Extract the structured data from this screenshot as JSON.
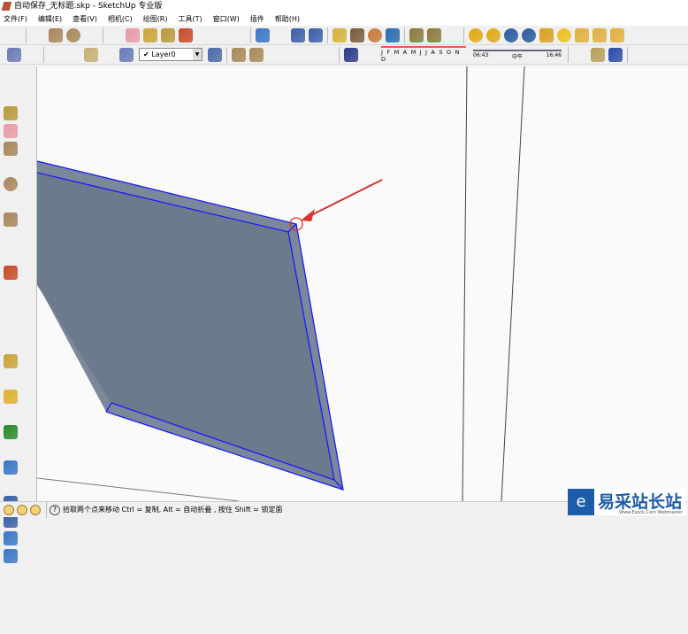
{
  "window": {
    "title": "自动保存_无标题.skp - SketchUp 专业版"
  },
  "menu": [
    "文件(F)",
    "编辑(E)",
    "查看(V)",
    "相机(C)",
    "绘图(R)",
    "工具(T)",
    "窗口(W)",
    "插件",
    "帮助(H)"
  ],
  "toolbar1": [
    {
      "icon": "select-arrow-icon",
      "color": "#333"
    },
    {
      "sep": true
    },
    {
      "icon": "pencil-icon",
      "color": "#d33"
    },
    {
      "icon": "rectangle-icon",
      "color": "#a8865a"
    },
    {
      "icon": "circle-icon",
      "color": "#a8865a"
    },
    {
      "icon": "arc-icon",
      "color": "#555"
    },
    {
      "sep": true
    },
    {
      "icon": "make-component-icon",
      "color": "#ccc"
    },
    {
      "icon": "eraser-icon",
      "color": "#e89aa8"
    },
    {
      "icon": "tape-measure-icon",
      "color": "#c9a43a"
    },
    {
      "icon": "paint-bucket-icon",
      "color": "#b89a3a"
    },
    {
      "icon": "push-pull-icon",
      "color": "#c94a2a"
    },
    {
      "icon": "move-icon",
      "color": "#d22"
    },
    {
      "icon": "rotate-icon",
      "color": "#d22"
    },
    {
      "icon": "follow-me-icon",
      "color": "#c33"
    },
    {
      "sep": true
    },
    {
      "icon": "orbit-icon",
      "color": "#3a76c4"
    },
    {
      "icon": "pan-icon",
      "color": "#aaa"
    },
    {
      "icon": "zoom-icon",
      "color": "#3a5ea8"
    },
    {
      "icon": "zoom-extents-icon",
      "color": "#3a5ea8"
    },
    {
      "sep": true
    },
    {
      "icon": "add-location-icon",
      "color": "#d6b23a"
    },
    {
      "icon": "photo-textures-icon",
      "color": "#7a5a3a"
    },
    {
      "icon": "google-earth-icon",
      "color": "#c8793a"
    },
    {
      "icon": "toggle-terrain-icon",
      "color": "#2a6ab0"
    },
    {
      "sep": true
    },
    {
      "icon": "get-models-icon",
      "color": "#8a7a3a"
    },
    {
      "icon": "share-model-icon",
      "color": "#8a7a3a"
    },
    {
      "icon": "share-component-icon",
      "color": "#ccc"
    },
    {
      "sep": true
    },
    {
      "icon": "m-plugin-icon",
      "color": "#e2a814"
    },
    {
      "icon": "plugin-icon",
      "color": "#e2a814"
    },
    {
      "icon": "r-plugin-icon",
      "color": "#2a5aa0"
    },
    {
      "icon": "help-icon",
      "color": "#2a5aa0"
    },
    {
      "icon": "tag-icon",
      "color": "#d8a020"
    },
    {
      "icon": "sun-icon",
      "color": "#f0c020"
    },
    {
      "icon": "light-icon",
      "color": "#e0b040"
    },
    {
      "icon": "spot-icon",
      "color": "#e0b040"
    },
    {
      "icon": "pin-icon",
      "color": "#e0b040"
    },
    {
      "icon": "sphere-icon",
      "color": "#bbb"
    }
  ],
  "toolbar2a": [
    {
      "icon": "xray-icon",
      "color": "#6a7ab8"
    },
    {
      "icon": "back-edges-icon",
      "color": "#ddd"
    },
    {
      "sep": true
    },
    {
      "icon": "wireframe-icon",
      "color": "#ddd"
    },
    {
      "icon": "hidden-line-icon",
      "color": "#eee"
    },
    {
      "icon": "shaded-icon",
      "color": "#c8b070"
    },
    {
      "icon": "shaded-textures-icon",
      "color": "#333"
    },
    {
      "icon": "monochrome-icon",
      "color": "#6a7ab8"
    }
  ],
  "layer": {
    "check": "✔",
    "name": "Layer0"
  },
  "toolbar2b": [
    {
      "icon": "layer-manager-icon",
      "color": "#4a6aa8"
    },
    {
      "sep": true
    },
    {
      "icon": "iso-view-icon",
      "color": "#a88a5a"
    },
    {
      "icon": "top-view-icon",
      "color": "#a88a5a"
    },
    {
      "icon": "front-view-icon",
      "color": "#333"
    },
    {
      "icon": "right-view-icon",
      "color": "#999"
    },
    {
      "icon": "back-view-icon",
      "color": "#777"
    },
    {
      "icon": "left-view-icon",
      "color": "#999"
    },
    {
      "sep": true
    },
    {
      "icon": "shadow-settings-icon",
      "color": "#2a3a8a"
    },
    {
      "icon": "display-shadows-icon",
      "color": "#222"
    }
  ],
  "shadows": {
    "months": "J F M A M J J A S O N D",
    "time_start": "06:43",
    "time_mid": "中午",
    "time_end": "16:46"
  },
  "toolbar2c": [
    {
      "sep": true
    },
    {
      "icon": "new-icon",
      "color": "#eee"
    },
    {
      "icon": "open-icon",
      "color": "#b8a05a"
    },
    {
      "icon": "save-icon",
      "color": "#2a4aa8"
    },
    {
      "sep": true
    },
    {
      "icon": "cut-icon",
      "color": "#c33"
    },
    {
      "icon": "copy-icon",
      "color": "#ddd"
    },
    {
      "icon": "paste-icon",
      "color": "#ddd"
    }
  ],
  "leftbar": [
    {
      "icon": "select-icon",
      "color": "#333"
    },
    {
      "icon": "component-icon",
      "color": "#ddd"
    },
    {
      "icon": "paint-bucket-icon",
      "color": "#b89a3a"
    },
    {
      "icon": "eraser-icon",
      "color": "#e89aa8"
    },
    {
      "icon": "rectangle-icon",
      "color": "#a8865a"
    },
    {
      "icon": "line-icon",
      "color": "#d33"
    },
    {
      "icon": "circle-icon",
      "color": "#a8865a"
    },
    {
      "icon": "arc-icon",
      "color": "#555"
    },
    {
      "icon": "polygon-icon",
      "color": "#a8865a"
    },
    {
      "icon": "freehand-icon",
      "color": "#555"
    },
    {
      "icon": "move-icon",
      "color": "#d22"
    },
    {
      "icon": "push-pull-icon",
      "color": "#c94a2a"
    },
    {
      "icon": "rotate-icon",
      "color": "#d22"
    },
    {
      "icon": "follow-me-icon",
      "color": "#c33"
    },
    {
      "icon": "scale-icon",
      "color": "#c33"
    },
    {
      "icon": "offset-icon",
      "color": "#c33"
    },
    {
      "icon": "tape-measure-icon",
      "color": "#c9a43a"
    },
    {
      "icon": "dimension-icon",
      "color": "#555"
    },
    {
      "icon": "protractor-icon",
      "color": "#e0b030"
    },
    {
      "icon": "text-icon",
      "color": "#666"
    },
    {
      "icon": "axes-icon",
      "color": "#2a8a2a"
    },
    {
      "icon": "3d-text-icon",
      "color": "#777"
    },
    {
      "icon": "orbit-icon",
      "color": "#3a76c4"
    },
    {
      "icon": "pan-icon",
      "color": "#aaa"
    },
    {
      "icon": "zoom-icon",
      "color": "#3a5ea8"
    },
    {
      "icon": "zoom-window-icon",
      "color": "#3a5ea8"
    },
    {
      "icon": "previous-view-icon",
      "color": "#3a76c4"
    },
    {
      "icon": "next-view-icon",
      "color": "#3a76c4"
    },
    {
      "icon": "walk-icon",
      "color": "#333"
    },
    {
      "icon": "look-around-icon",
      "color": "#555"
    },
    {
      "icon": "position-camera-icon",
      "color": "#333"
    },
    {
      "icon": "section-plane-icon",
      "color": "#555"
    }
  ],
  "status": {
    "hint": "拾取两个点来移动 Ctrl = 复制, Alt = 自动折叠 ,  按住 Shift = 锁定面"
  },
  "watermark": {
    "text": "易采站长站",
    "sub": "Www.Easck.Com  Webmaster"
  },
  "colors": {
    "face": "#6b7a8c",
    "edge": "#1a1aff",
    "arrow": "#e03030"
  }
}
